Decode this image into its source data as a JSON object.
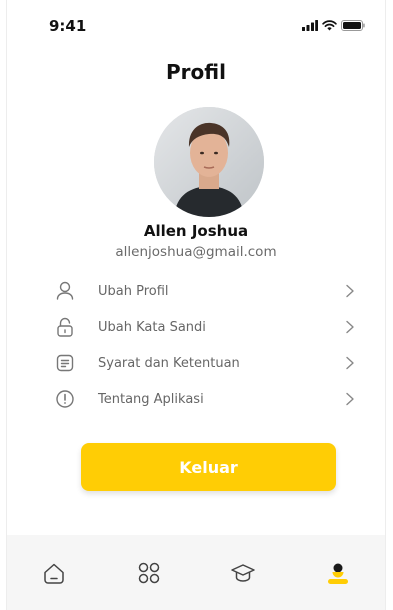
{
  "status_bar": {
    "time": "9:41",
    "icons": [
      "signal-icon",
      "wifi-icon",
      "battery-icon"
    ]
  },
  "page": {
    "title": "Profil"
  },
  "profile": {
    "name": "Allen Joshua",
    "email": "allenjoshua@gmail.com"
  },
  "menu": {
    "items": [
      {
        "label": "Ubah Profil",
        "icon": "user-icon"
      },
      {
        "label": "Ubah Kata Sandi",
        "icon": "lock-icon"
      },
      {
        "label": "Syarat dan Ketentuan",
        "icon": "document-icon"
      },
      {
        "label": "Tentang Aplikasi",
        "icon": "info-icon"
      }
    ]
  },
  "actions": {
    "logout_label": "Keluar"
  },
  "bottom_nav": {
    "tabs": [
      "home-icon",
      "categories-icon",
      "courses-icon",
      "profile-icon"
    ],
    "active_tab": "profile-icon"
  },
  "colors": {
    "accent": "#ffcd05",
    "text_primary": "#111111",
    "text_secondary": "#666666",
    "nav_background": "#f6f6f6"
  }
}
